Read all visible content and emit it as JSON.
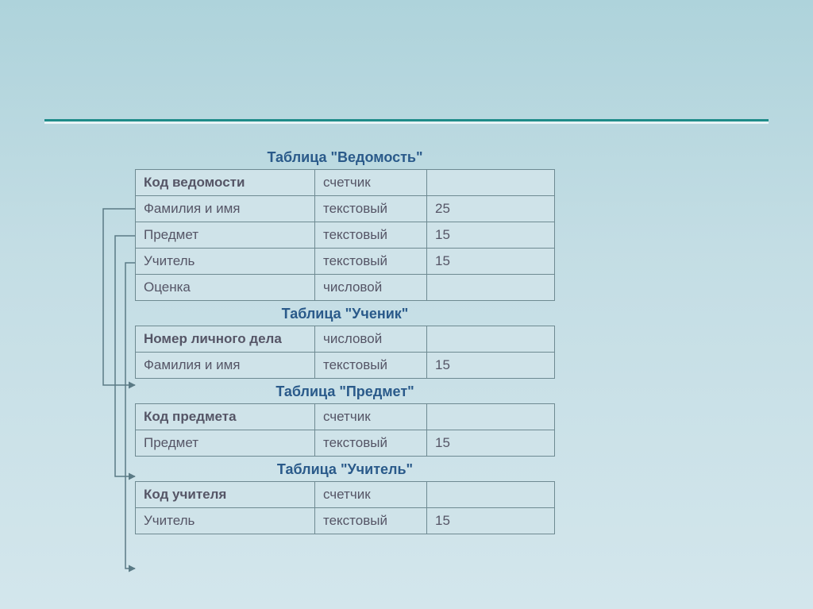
{
  "tables": {
    "t1": {
      "title": "Таблица \"Ведомость\"",
      "rows": [
        {
          "field": "Код ведомости",
          "type": "счетчик",
          "size": "",
          "key": true
        },
        {
          "field": "Фамилия и имя",
          "type": "текстовый",
          "size": "25",
          "key": false
        },
        {
          "field": "Предмет",
          "type": "текстовый",
          "size": "15",
          "key": false
        },
        {
          "field": "Учитель",
          "type": "текстовый",
          "size": "15",
          "key": false
        },
        {
          "field": "Оценка",
          "type": "числовой",
          "size": "",
          "key": false
        }
      ]
    },
    "t2": {
      "title": "Таблица \"Ученик\"",
      "rows": [
        {
          "field": "Номер личного дела",
          "type": "числовой",
          "size": "",
          "key": true
        },
        {
          "field": "Фамилия и имя",
          "type": "текстовый",
          "size": "15",
          "key": false
        }
      ]
    },
    "t3": {
      "title": "Таблица \"Предмет\"",
      "rows": [
        {
          "field": "Код предмета",
          "type": "счетчик",
          "size": "",
          "key": true
        },
        {
          "field": "Предмет",
          "type": "текстовый",
          "size": "15",
          "key": false
        }
      ]
    },
    "t4": {
      "title": "Таблица \"Учитель\"",
      "rows": [
        {
          "field": "Код учителя",
          "type": "счетчик",
          "size": "",
          "key": true
        },
        {
          "field": "Учитель",
          "type": "текстовый",
          "size": "15",
          "key": false
        }
      ]
    }
  }
}
